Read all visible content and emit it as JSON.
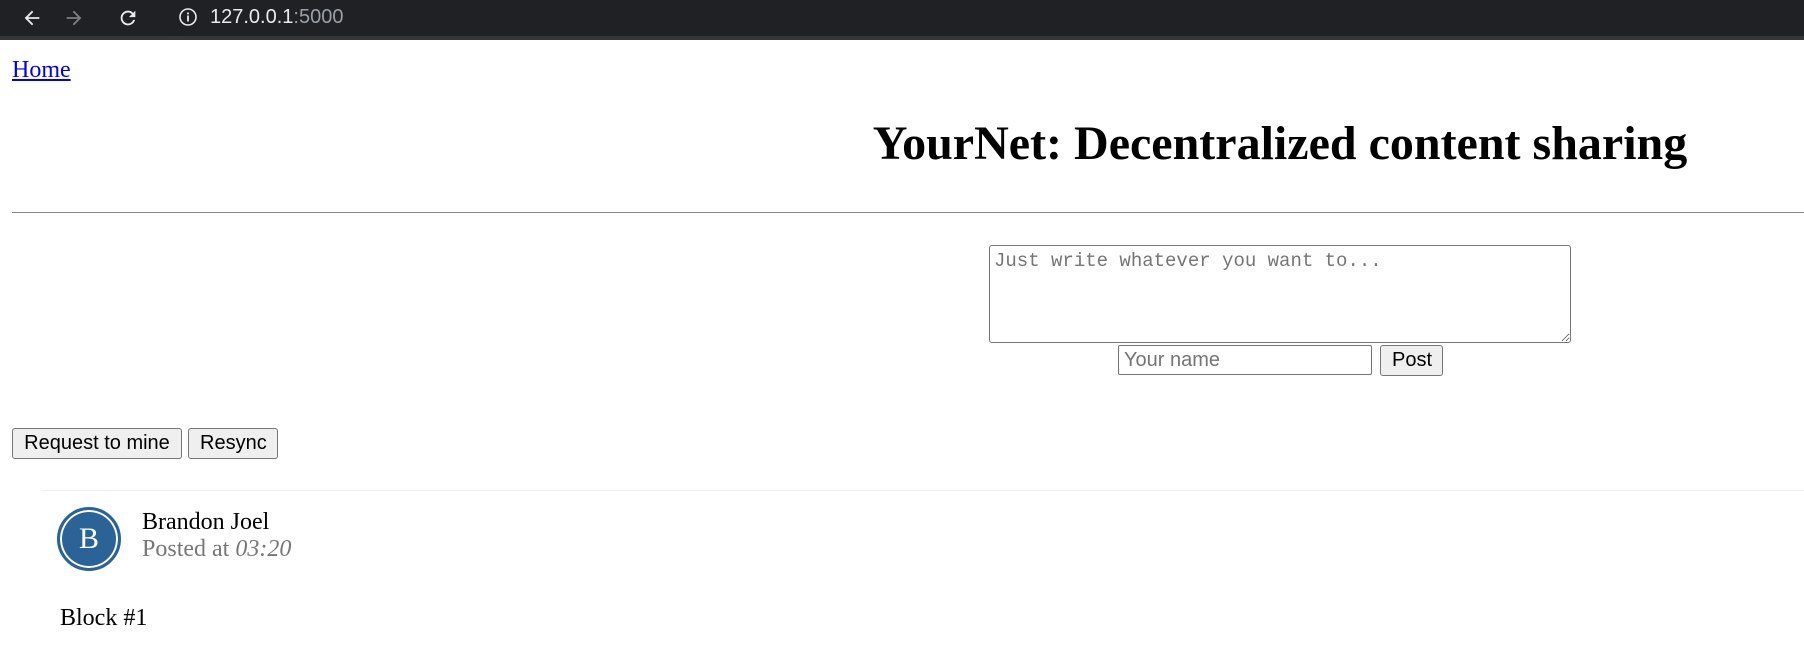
{
  "browser": {
    "url_host": "127.0.0.1",
    "url_port": ":5000"
  },
  "nav": {
    "home_label": "Home"
  },
  "header": {
    "title": "YourNet: Decentralized content sharing"
  },
  "compose": {
    "content_placeholder": "Just write whatever you want to...",
    "name_placeholder": "Your name",
    "post_label": "Post"
  },
  "actions": {
    "mine_label": "Request to mine",
    "resync_label": "Resync"
  },
  "posts": [
    {
      "avatar_initial": "B",
      "author": "Brandon Joel",
      "posted_prefix": "Posted at",
      "time": "03:20",
      "content": "Block #1"
    }
  ],
  "colors": {
    "avatar_bg": "#2a6496",
    "link": "#0000ee",
    "chrome_bg": "#202124"
  }
}
